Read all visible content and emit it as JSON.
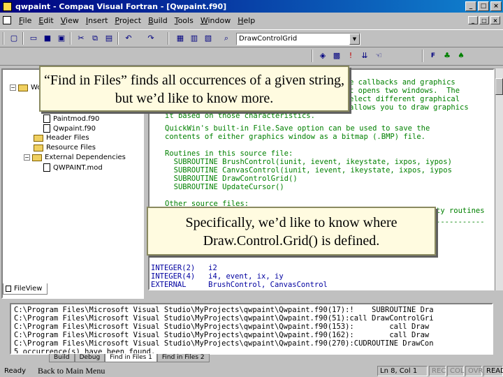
{
  "window": {
    "title": "qwpaint - Compaq Visual Fortran - [Qwpaint.f90]",
    "minimize": "_",
    "maximize": "□",
    "close": "×"
  },
  "menu": [
    "File",
    "Edit",
    "View",
    "Insert",
    "Project",
    "Build",
    "Tools",
    "Window",
    "Help"
  ],
  "toolbar": {
    "function_combo": "DrawControlGrid",
    "icons": [
      "new-icon",
      "open-icon",
      "save-icon",
      "save-all-icon",
      "cut-icon",
      "copy-icon",
      "paste-icon",
      "undo-icon",
      "redo-icon",
      "workspace-icon",
      "output-icon",
      "find-in-files-icon",
      "build-icon",
      "compile-icon",
      "stop-icon",
      "go-icon",
      "breakpoint-icon"
    ]
  },
  "workspace": {
    "root": "Wo",
    "items": [
      "Paintmod.f90",
      "Qwpaint.f90",
      "Header Files",
      "Resource Files",
      "External Dependencies",
      "QWPAINT.mod"
    ],
    "tab": "FileView"
  },
  "editor": {
    "lines_top": [
      "e callbacks and graphics",
      "t opens two windows.  The",
      "elect different graphical",
      "allows you to draw graphics",
      "it based on those characteristics."
    ],
    "lines_mid": [
      "",
      "QuickWin's built-in File.Save option can be used to save the",
      "contents of either graphics window as a bitmap (.BMP) file.",
      "",
      "Routines in this source file:",
      "  SUBROUTINE BrushControl(iunit, ievent, ikeystate, ixpos, iypos)",
      "  SUBROUTINE CanvasControl(iunit, ievent, ikeystate, ixpos, iypos",
      "  SUBROUTINE DrawControlGrid()",
      "  SUBROUTINE UpdateCursor()",
      "",
      "Other source files:"
    ],
    "line_frag": "ty routines",
    "lines_bottom": [
      "INTEGER(2)   i2",
      "INTEGER(4)   i4, event, ix, iy",
      "EXTERNAL     BrushControl, CanvasControl"
    ]
  },
  "output": {
    "lines": [
      "C:\\Program Files\\Microsoft Visual Studio\\MyProjects\\qwpaint\\Qwpaint.f90(17):!    SUBROUTINE Dra",
      "C:\\Program Files\\Microsoft Visual Studio\\MyProjects\\qwpaint\\Qwpaint.f90(51):call DrawControlGri",
      "C:\\Program Files\\Microsoft Visual Studio\\MyProjects\\qwpaint\\Qwpaint.f90(153):        call Draw",
      "C:\\Program Files\\Microsoft Visual Studio\\MyProjects\\qwpaint\\Qwpaint.f90(162):        call Draw",
      "C:\\Program Files\\Microsoft Visual Studio\\MyProjects\\qwpaint\\Qwpaint.f90(270):CUDROUTINE DrawCon",
      "5 occurrence(s) have been found."
    ],
    "tabs": [
      "Build",
      "Debug",
      "Find in Files 1",
      "Find in Files 2"
    ]
  },
  "status": {
    "ready": "Ready",
    "back": "Back to Main Menu",
    "position": "Ln 8, Col 1",
    "rec": "REC",
    "col": "COL",
    "ovr": "OVR",
    "read": "READ"
  },
  "callouts": {
    "first": "“Find in Files” finds all occurrences of a given string, but we’d like to know more.",
    "second": "Specifically, we’d like to know where Draw.Control.Grid() is defined."
  }
}
